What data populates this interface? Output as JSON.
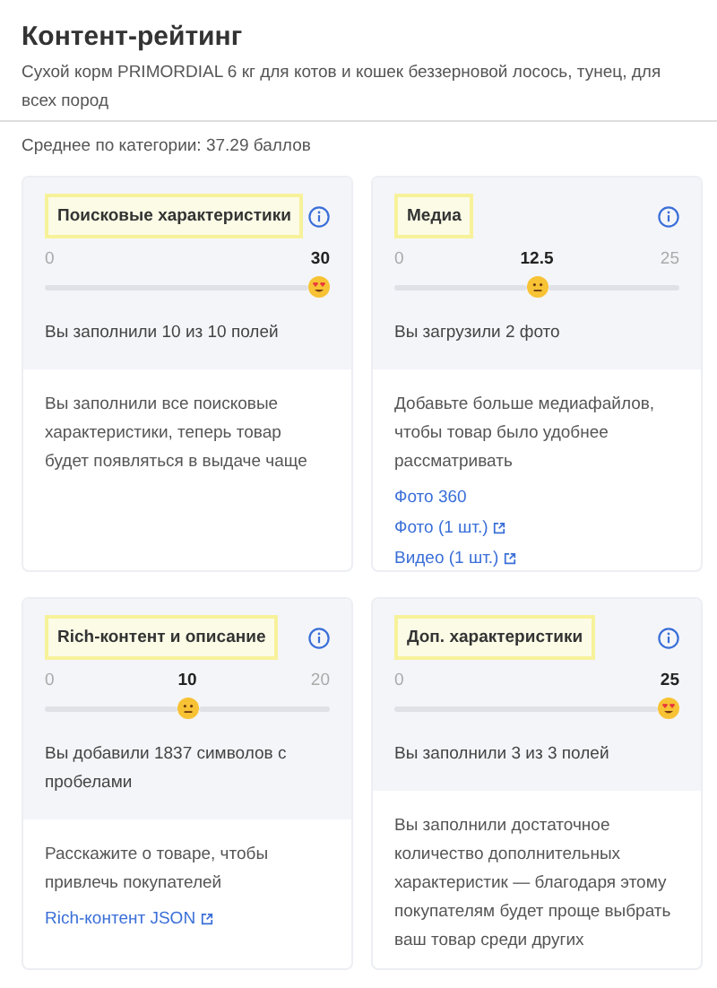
{
  "header": {
    "title": "Контент-рейтинг",
    "product": "Сухой корм PRIMORDIAL 6 кг для котов и кошек беззерновой лосось, тунец, для всех пород"
  },
  "category_average": "Среднее по категории: 37.29 баллов",
  "cards": [
    {
      "title": "Поисковые характеристики",
      "min": "0",
      "value": "30",
      "level": 1,
      "kind": "full",
      "status": "Вы заполнили 10 из 10 полей",
      "advice": "Вы заполнили все поисковые характеристики, теперь товар будет появляться в выдаче чаще"
    },
    {
      "title": "Медиа",
      "min": "0",
      "value": "12.5",
      "max": "25",
      "level": 0.5,
      "kind": "partial",
      "status": "Вы загрузили 2 фото",
      "advice": "Добавьте больше медиафайлов, чтобы товар было удобнее рассматривать",
      "links": [
        {
          "label": "Фото 360",
          "external": false
        },
        {
          "label": "Фото (1 шт.)",
          "external": true
        },
        {
          "label": "Видео (1 шт.)",
          "external": true
        }
      ]
    },
    {
      "title": "Rich-контент и описание",
      "min": "0",
      "value": "10",
      "max": "20",
      "level": 0.5,
      "kind": "partial",
      "status": "Вы добавили 1837 символов с пробелами",
      "advice": "Расскажите о товаре, чтобы привлечь покупателей",
      "links": [
        {
          "label": "Rich-контент JSON",
          "external": true
        }
      ]
    },
    {
      "title": "Доп. характеристики",
      "min": "0",
      "value": "25",
      "level": 1,
      "kind": "full",
      "status": "Вы заполнили 3 из 3 полей",
      "advice": "Вы заполнили достаточное количество дополнительных характеристик — благодаря этому покупателям будет проще выбрать ваш товар среди других"
    }
  ]
}
